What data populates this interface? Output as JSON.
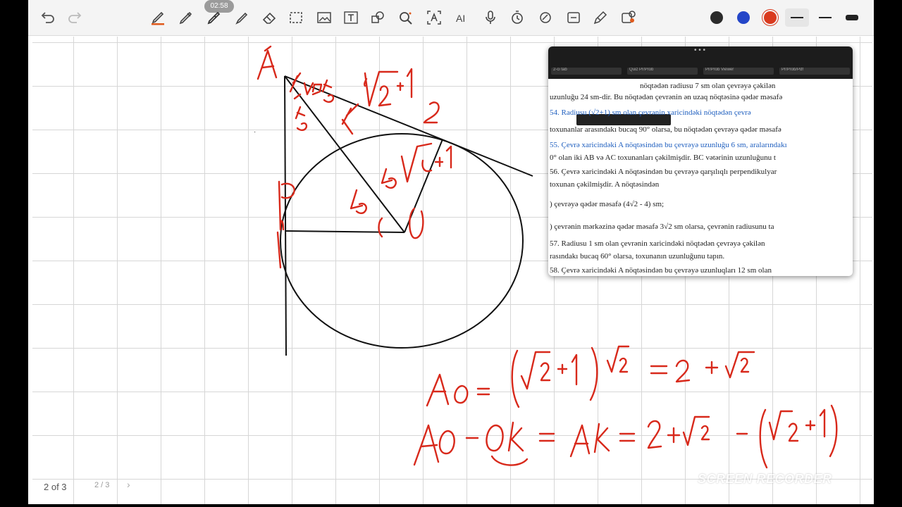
{
  "toolbar": {
    "timer": "02:58",
    "tools": [
      "undo-icon",
      "redo-icon",
      "pen-icon",
      "pencil-icon",
      "highlighter-icon",
      "marker-icon",
      "eraser-icon",
      "lasso-icon",
      "image-icon",
      "text-icon",
      "shapes-icon",
      "zoom-icon",
      "text-recognition-icon",
      "ai-icon",
      "mic-icon",
      "timer-icon",
      "laser-icon",
      "scan-icon",
      "tag-icon",
      "sticker-icon"
    ],
    "colors": [
      "#2b2b2b",
      "#2446c8",
      "#d93a1e"
    ],
    "accent": "#e05a1c"
  },
  "canvas": {
    "handwriting": {
      "labels": [
        "A",
        "K",
        "2",
        "B",
        "O",
        "45",
        "45",
        "45",
        "45",
        "√2+1",
        "√2+1"
      ],
      "eq1": "AO = (√2+1)√2 = 2 + √2",
      "eq2": "AO-OK = AK = 2+√2 - (√2+1)"
    }
  },
  "pager": {
    "indicator": "2 of 3",
    "pill": "2 / 3"
  },
  "popup": {
    "tabs": [
      "2-ci tab",
      "Quiz Pr/Prob",
      "Pr/Prob Viewer",
      "Pr/Prob/Pdf"
    ],
    "lines": [
      "nöqtədən radiusu 7 sm olan çevrəyə çəkilən",
      "uzunluğu 24 sm-dir. Bu nöqtədən çevrənin ən uzaq nöqtəsinə qədər məsafə",
      "54. Radiusu (√2+1) sm olan çevrənin xaricindəki nöqtədən çevrə",
      "toxunanlar arasındakı bucaq 90° olarsa, bu nöqtədən çevrəyə qədər məsafə",
      "55. Çevrə xaricindəki A nöqtəsindən bu çevrəyə uzunluğu 6 sm, aralarındakı",
      "0° olan iki AB və AC toxunanları çəkilmişdir. BC vətərinin uzunluğunu t",
      "56. Çevrə xaricindəki A nöqtəsindən bu çevrəyə qarşılıqlı perpendikulyar",
      "toxunan çəkilmişdir. A nöqtəsindən",
      ") çevrəyə qədər məsafə (4√2 - 4) sm;",
      ") çevrənin mərkəzinə qədər məsafə 3√2 sm olarsa, çevrənin radiusunu ta",
      "57. Radiusu 1 sm olan çevrənin xaricindəki nöqtədən çevrəyə çəkilən",
      "rasındakı bucaq 60° olarsa, toxunanın uzunluğunu tapın.",
      "58. Çevrə xaricindəki A nöqtəsindən bu çevrəyə uzunluqları 12 sm olan"
    ]
  },
  "watermark": "SCREEN RECORDER"
}
